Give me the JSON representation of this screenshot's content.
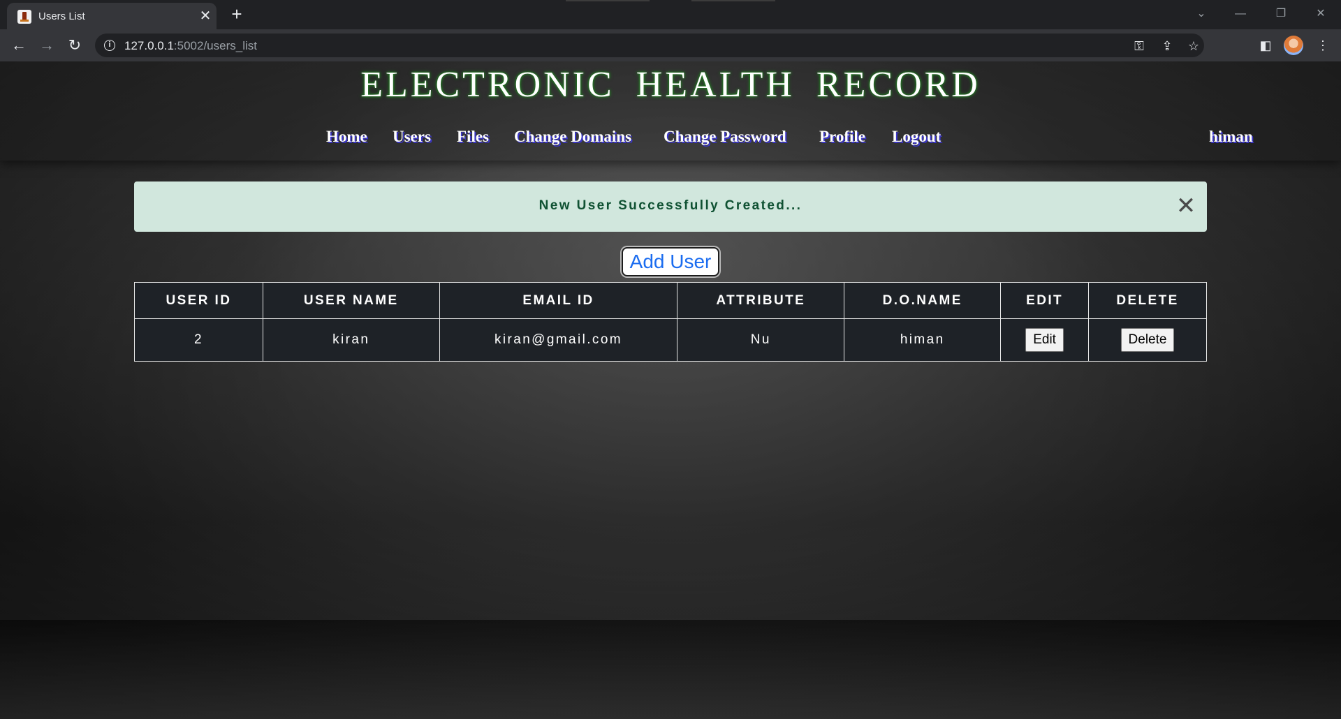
{
  "browser": {
    "tab_title": "Users List",
    "url_host": "127.0.0.1",
    "url_path": ":5002/users_list",
    "icons": [
      "back-icon",
      "forward-icon",
      "reload-icon",
      "info-icon",
      "key-icon",
      "share-icon",
      "star-icon",
      "side-panel-icon",
      "kebab-menu-icon"
    ]
  },
  "site": {
    "title": "ELECTRONIC HEALTH RECORD",
    "username": "himan"
  },
  "nav": {
    "home": "Home",
    "users": "Users",
    "files": "Files",
    "change_domains": "Change Domains",
    "change_password": "Change Password",
    "profile": "Profile",
    "logout": "Logout"
  },
  "alert": {
    "message": "New User Successfully Created..."
  },
  "actions": {
    "add_user": "Add User"
  },
  "table": {
    "headers": [
      "USER ID",
      "USER NAME",
      "EMAIL ID",
      "ATTRIBUTE",
      "D.O.NAME",
      "EDIT",
      "DELETE"
    ],
    "rows": [
      {
        "user_id": "2",
        "user_name": "kiran",
        "email": "kiran@gmail.com",
        "attribute": "Nu",
        "do_name": "himan",
        "edit_label": "Edit",
        "delete_label": "Delete"
      }
    ]
  },
  "colors": {
    "alert_bg": "#d1e7dd",
    "alert_text": "#0f5132",
    "nav_shadow": "#3b36c9",
    "title_glow": "#1a7a1a",
    "add_user_text": "#1a6cf0"
  }
}
